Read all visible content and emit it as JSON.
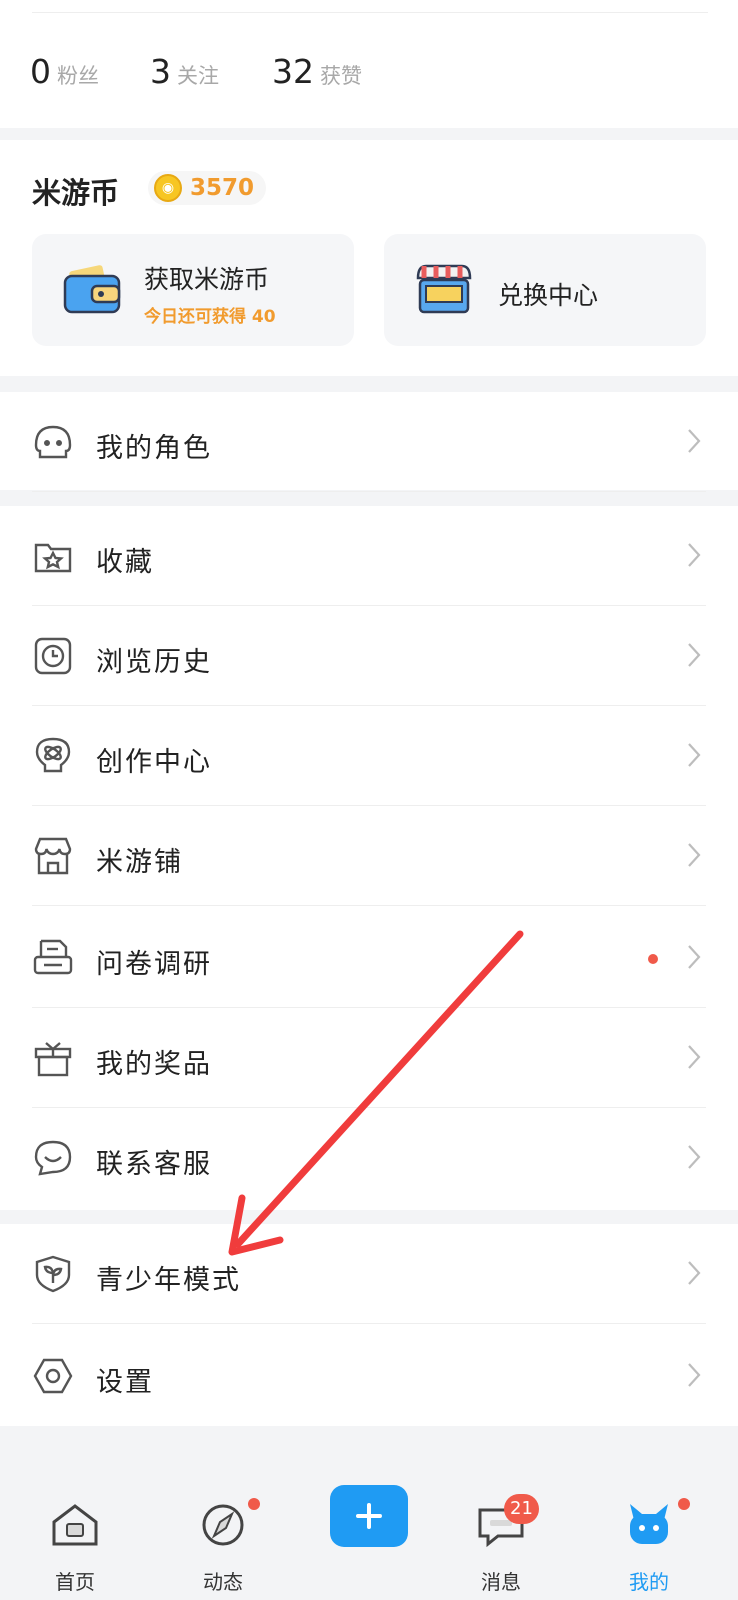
{
  "stats": [
    {
      "num": "0",
      "label": "粉丝"
    },
    {
      "num": "3",
      "label": "关注"
    },
    {
      "num": "32",
      "label": "获赞"
    }
  ],
  "coins": {
    "title": "米游币",
    "amount": "3570",
    "tile_left": {
      "title": "获取米游币",
      "subtitle": "今日还可获得 40"
    },
    "tile_right": {
      "title": "兑换中心"
    }
  },
  "menu": [
    {
      "label": "我的角色",
      "icon": "character-icon"
    },
    {
      "label": "收藏",
      "icon": "favorites-folder-icon"
    },
    {
      "label": "浏览历史",
      "icon": "clock-icon"
    },
    {
      "label": "创作中心",
      "icon": "lightbulb-icon"
    },
    {
      "label": "米游铺",
      "icon": "shop-icon"
    },
    {
      "label": "问卷调研",
      "icon": "survey-icon"
    },
    {
      "label": "我的奖品",
      "icon": "gift-icon"
    },
    {
      "label": "联系客服",
      "icon": "chat-smile-icon"
    },
    {
      "label": "青少年模式",
      "icon": "shield-leaf-icon"
    },
    {
      "label": "设置",
      "icon": "settings-hexagon-icon"
    }
  ],
  "tabs": [
    {
      "label": "首页"
    },
    {
      "label": "动态"
    },
    {
      "label": "消息",
      "badge": "21"
    },
    {
      "label": "我的"
    }
  ],
  "colors": {
    "accent": "#1f9bf3",
    "coin": "#f19b2e",
    "badge": "#f05a4a",
    "annotation": "#f03c3c"
  }
}
